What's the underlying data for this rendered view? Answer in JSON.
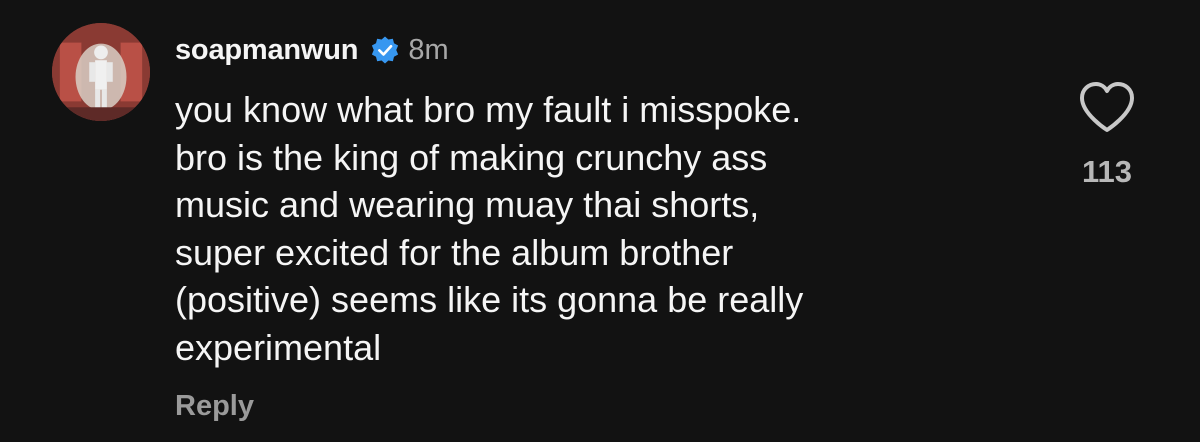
{
  "comment": {
    "username": "soapmanwun",
    "verified_icon": "verified-badge-icon",
    "timestamp": "8m",
    "body_lines": [
      "you know what bro my fault i misspoke.",
      "bro is the king of making crunchy ass",
      "music and wearing muay thai shorts,",
      "super excited for the album brother",
      "(positive) seems like its gonna be really",
      "experimental"
    ],
    "reply_label": "Reply",
    "like_icon": "heart-icon",
    "like_count": "113"
  },
  "colors": {
    "background": "#121212",
    "text_primary": "#f5f5f5",
    "text_secondary": "#a8a8a8",
    "verified_blue": "#3797f0"
  }
}
